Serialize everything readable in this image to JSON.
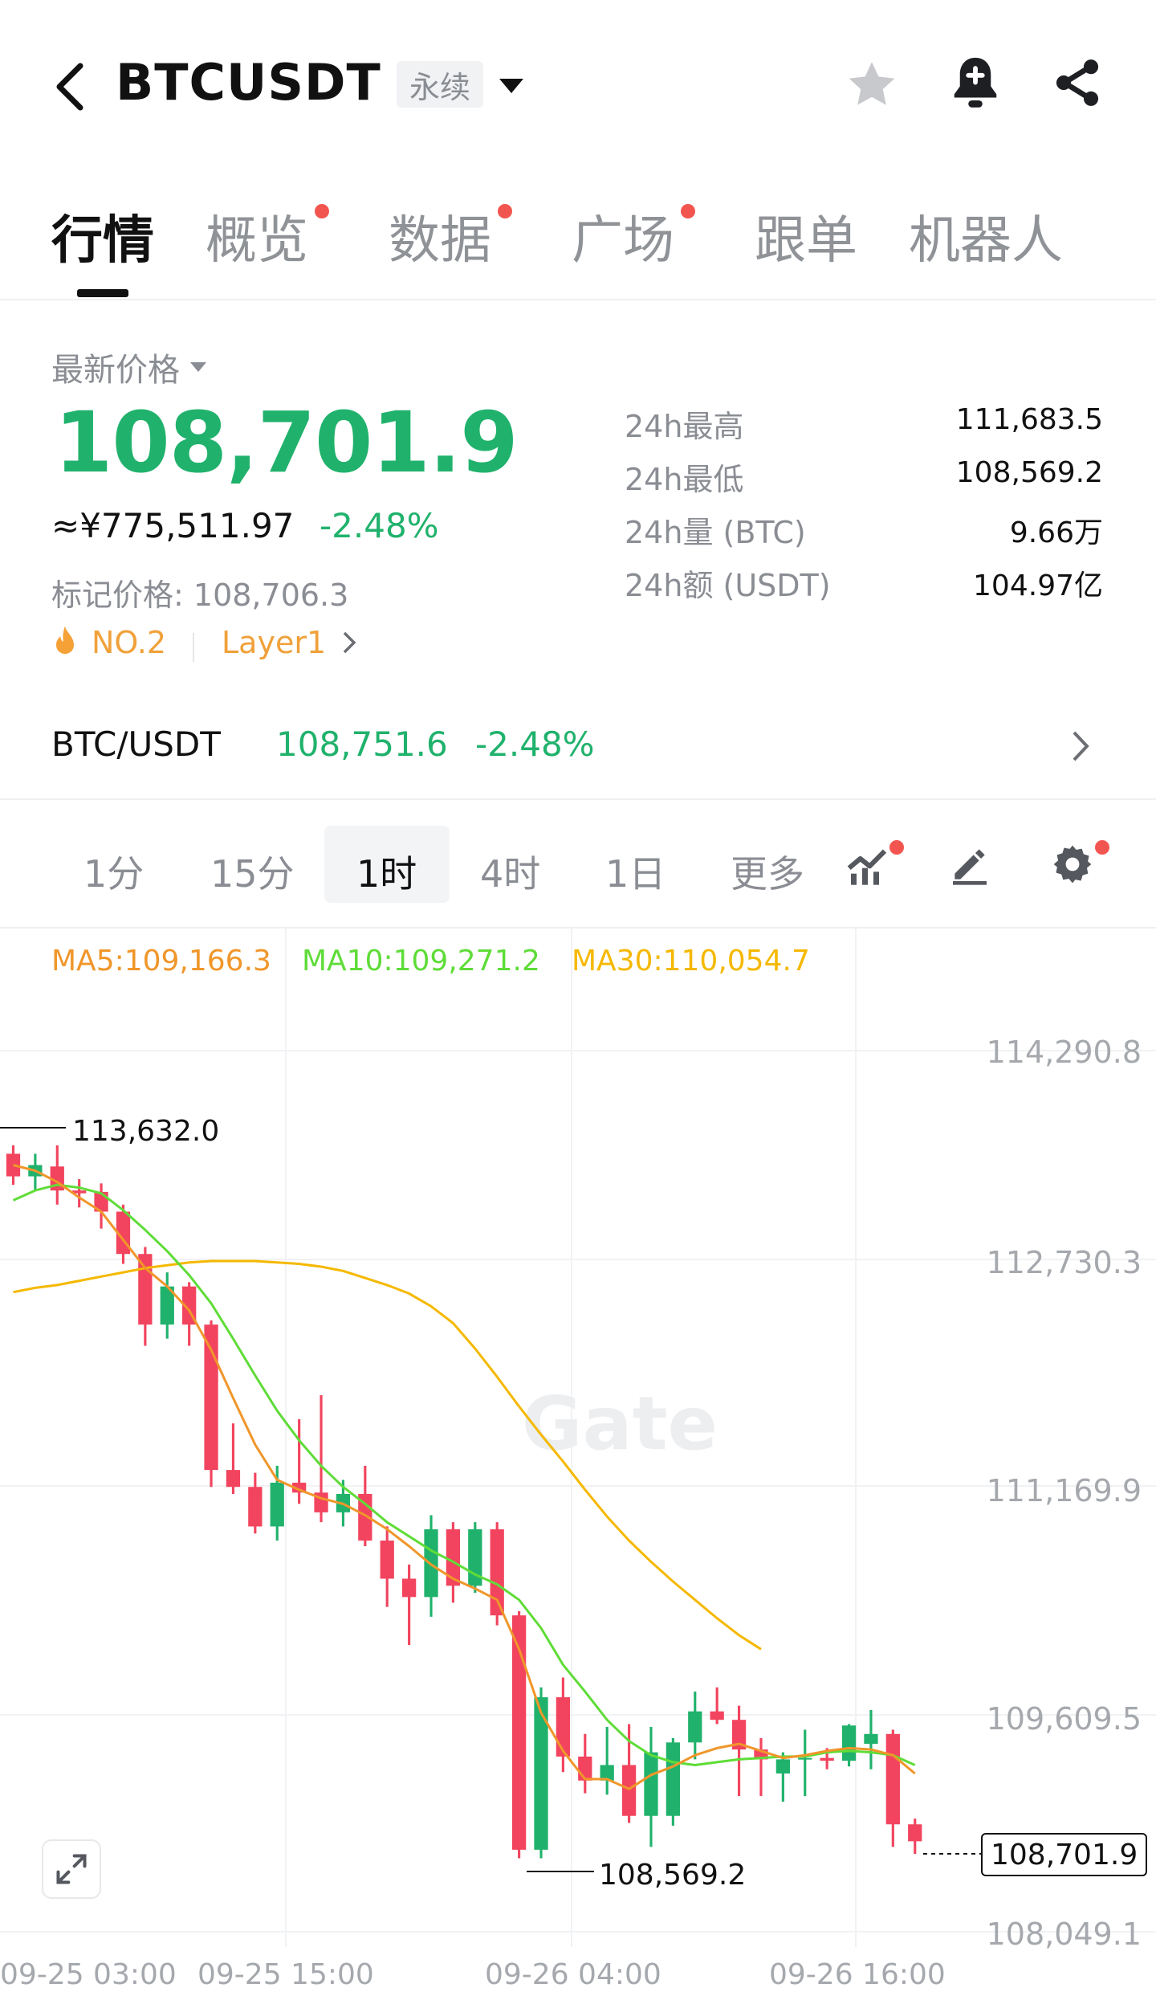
{
  "header": {
    "symbol": "BTCUSDT",
    "contract_type": "永续"
  },
  "tabs": [
    {
      "label": "行情",
      "active": true,
      "dot": false
    },
    {
      "label": "概览",
      "active": false,
      "dot": true
    },
    {
      "label": "数据",
      "active": false,
      "dot": true
    },
    {
      "label": "广场",
      "active": false,
      "dot": true
    },
    {
      "label": "跟单",
      "active": false,
      "dot": false
    },
    {
      "label": "机器人",
      "active": false,
      "dot": false
    }
  ],
  "price": {
    "label": "最新价格",
    "last": "108,701.9",
    "cny": "≈¥775,511.97",
    "change": "-2.48%",
    "mark_label": "标记价格:",
    "mark_value": "108,706.3",
    "rank": "NO.2",
    "category": "Layer1"
  },
  "stats": [
    {
      "label": "24h最高",
      "value": "111,683.5"
    },
    {
      "label": "24h最低",
      "value": "108,569.2"
    },
    {
      "label": "24h量 (BTC)",
      "value": "9.66万"
    },
    {
      "label": "24h额 (USDT)",
      "value": "104.97亿"
    }
  ],
  "spot": {
    "pair": "BTC/USDT",
    "price": "108,751.6",
    "change": "-2.48%"
  },
  "intervals": [
    "1分",
    "15分",
    "1时",
    "4时",
    "1日",
    "更多"
  ],
  "selected_interval": "1时",
  "ma": {
    "ma5": "MA5:109,166.3",
    "ma10": "MA10:109,271.2",
    "ma30": "MA30:110,054.7"
  },
  "colors": {
    "up": "#20b26c",
    "down": "#f2445e",
    "ma5": "#f0962a",
    "ma10": "#5fdc38",
    "ma30": "#f5b800",
    "dot": "#f2554f"
  },
  "chart_data": {
    "type": "candlestick",
    "ylim": [
      107800,
      114600
    ],
    "y_ticks": [
      "114,290.8",
      "112,730.3",
      "111,169.9",
      "109,609.5",
      "108,049.1"
    ],
    "x_ticks": [
      "09-25 03:00",
      "09-25 15:00",
      "09-26 04:00",
      "09-26 16:00"
    ],
    "high_marker": "113,632.0",
    "low_marker": "108,569.2",
    "last_price": "108,701.9",
    "watermark": "Gate",
    "candles": [
      [
        113560,
        113400,
        113620,
        113340
      ],
      [
        113400,
        113480,
        113560,
        113300
      ],
      [
        113470,
        113300,
        113620,
        113200
      ],
      [
        113300,
        113280,
        113380,
        113180
      ],
      [
        113290,
        113150,
        113350,
        113030
      ],
      [
        113150,
        112850,
        113200,
        112780
      ],
      [
        112850,
        112350,
        112900,
        112200
      ],
      [
        112350,
        112620,
        112720,
        112250
      ],
      [
        112620,
        112350,
        112650,
        112200
      ],
      [
        112350,
        111320,
        112380,
        111200
      ],
      [
        111320,
        111200,
        111650,
        111150
      ],
      [
        111200,
        110920,
        111300,
        110870
      ],
      [
        110920,
        111230,
        111350,
        110820
      ],
      [
        111230,
        111160,
        111680,
        111080
      ],
      [
        111160,
        111020,
        111850,
        110950
      ],
      [
        111020,
        111150,
        111250,
        110920
      ],
      [
        111150,
        110820,
        111350,
        110780
      ],
      [
        110820,
        110550,
        110920,
        110350
      ],
      [
        110550,
        110420,
        110650,
        110080
      ],
      [
        110420,
        110900,
        111000,
        110280
      ],
      [
        110900,
        110500,
        110950,
        110380
      ],
      [
        110500,
        110900,
        110950,
        110450
      ],
      [
        110900,
        110290,
        110950,
        110220
      ],
      [
        110290,
        108630,
        110320,
        108570
      ],
      [
        108630,
        109710,
        109780,
        108570
      ],
      [
        109710,
        109290,
        109850,
        109180
      ],
      [
        109290,
        109120,
        109450,
        109030
      ],
      [
        109120,
        109230,
        109500,
        109020
      ],
      [
        109230,
        108870,
        109520,
        108820
      ],
      [
        108870,
        109320,
        109500,
        108650
      ],
      [
        108870,
        109390,
        109420,
        108800
      ],
      [
        109390,
        109610,
        109750,
        109270
      ],
      [
        109610,
        109550,
        109780,
        109520
      ],
      [
        109550,
        109340,
        109650,
        109010
      ],
      [
        109340,
        109270,
        109420,
        109010
      ],
      [
        109170,
        109270,
        109320,
        108970
      ],
      [
        109270,
        109280,
        109480,
        109010
      ],
      [
        109280,
        109260,
        109350,
        109200
      ],
      [
        109260,
        109510,
        109520,
        109220
      ],
      [
        109380,
        109450,
        109620,
        109200
      ],
      [
        109450,
        108810,
        109480,
        108650
      ],
      [
        108810,
        108690,
        108850,
        108600
      ]
    ],
    "ma5": [
      113480,
      113440,
      113360,
      113250,
      113150,
      112950,
      112750,
      112620,
      112450,
      112170,
      111830,
      111500,
      111250,
      111180,
      111120,
      111080,
      111000,
      110900,
      110780,
      110650,
      110550,
      110480,
      110400,
      110050,
      109600,
      109330,
      109130,
      109130,
      109060,
      109160,
      109220,
      109300,
      109350,
      109380,
      109330,
      109280,
      109300,
      109330,
      109350,
      109340,
      109300,
      109170
    ],
    "ma10": [
      113230,
      113300,
      113340,
      113320,
      113280,
      113160,
      113020,
      112870,
      112700,
      112500,
      112250,
      111990,
      111740,
      111530,
      111350,
      111200,
      111080,
      110950,
      110850,
      110750,
      110670,
      110580,
      110510,
      110400,
      110200,
      109940,
      109750,
      109550,
      109400,
      109300,
      109250,
      109230,
      109250,
      109270,
      109280,
      109290,
      109290,
      109320,
      109330,
      109320,
      109300,
      109230
    ],
    "ma30": [
      112580,
      112610,
      112630,
      112660,
      112690,
      112720,
      112750,
      112770,
      112790,
      112800,
      112800,
      112800,
      112790,
      112780,
      112760,
      112730,
      112680,
      112630,
      112570,
      112480,
      112360,
      112180,
      111980,
      111770,
      111570,
      111380,
      111180,
      110990,
      110820,
      110670,
      110530,
      110400,
      110270,
      110150,
      110050
    ]
  }
}
